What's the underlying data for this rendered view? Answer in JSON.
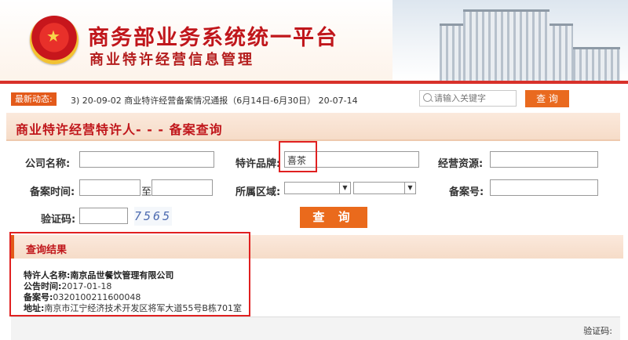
{
  "header": {
    "title": "商务部业务系统统一平台",
    "subtitle": "商业特许经营信息管理"
  },
  "nav": {
    "news_tag": "最新动态:",
    "news_text": "3)   20-09-02   商业特许经营备案情况通报（6月14日-6月30日）  20-07-14",
    "search_placeholder": "请输入关键字",
    "search_button": "查 询"
  },
  "panel": {
    "title": "商业特许经营特许人- - - 备案查询"
  },
  "form": {
    "company_label": "公司名称:",
    "company_value": "",
    "brand_label": "特许品牌:",
    "brand_value": "喜茶",
    "resource_label": "经营资源:",
    "resource_value": "",
    "date_label": "备案时间:",
    "date_to": "至",
    "region_label": "所属区域:",
    "record_label": "备案号:",
    "captcha_label": "验证码:",
    "captcha_text": "7565",
    "query_button": "查 询"
  },
  "result": {
    "title": "查询结果",
    "rows": [
      {
        "label": "特许人名称:",
        "value": "南京品世餐饮管理有限公司"
      },
      {
        "label": "公告时间:",
        "value": "2017-01-18"
      },
      {
        "label": "备案号:",
        "value": "0320100211600048"
      },
      {
        "label": "地址:",
        "value": "南京市江宁经济技术开发区将军大道55号B栋701室"
      }
    ],
    "footer_captcha_label": "验证码:"
  },
  "colors": {
    "brand_red": "#c0161b",
    "accent_orange": "#ea6a1c",
    "highlight_box": "#e02020"
  }
}
